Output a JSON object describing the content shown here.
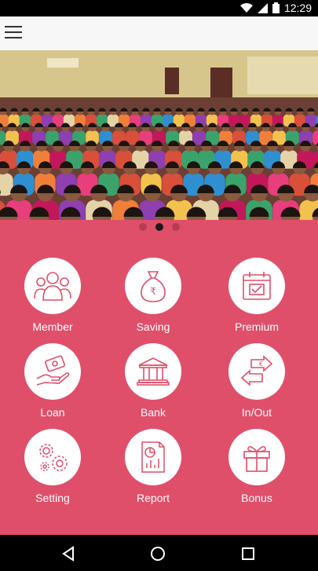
{
  "status": {
    "time": "12:29"
  },
  "carousel": {
    "pages": 3,
    "active_index": 1
  },
  "menu": [
    {
      "label": "Member",
      "icon": "members-icon"
    },
    {
      "label": "Saving",
      "icon": "money-bag-rupee-icon"
    },
    {
      "label": "Premium",
      "icon": "calendar-check-icon"
    },
    {
      "label": "Loan",
      "icon": "hand-money-icon"
    },
    {
      "label": "Bank",
      "icon": "bank-icon"
    },
    {
      "label": "In/Out",
      "icon": "exchange-arrows-icon"
    },
    {
      "label": "Setting",
      "icon": "gears-icon"
    },
    {
      "label": "Report",
      "icon": "report-icon"
    },
    {
      "label": "Bonus",
      "icon": "gift-icon"
    }
  ],
  "colors": {
    "primary": "#e04f6a",
    "app_bar": "#f7f7f7",
    "dot_active": "#1a1a1a",
    "dot_inactive": "#b63c54"
  }
}
